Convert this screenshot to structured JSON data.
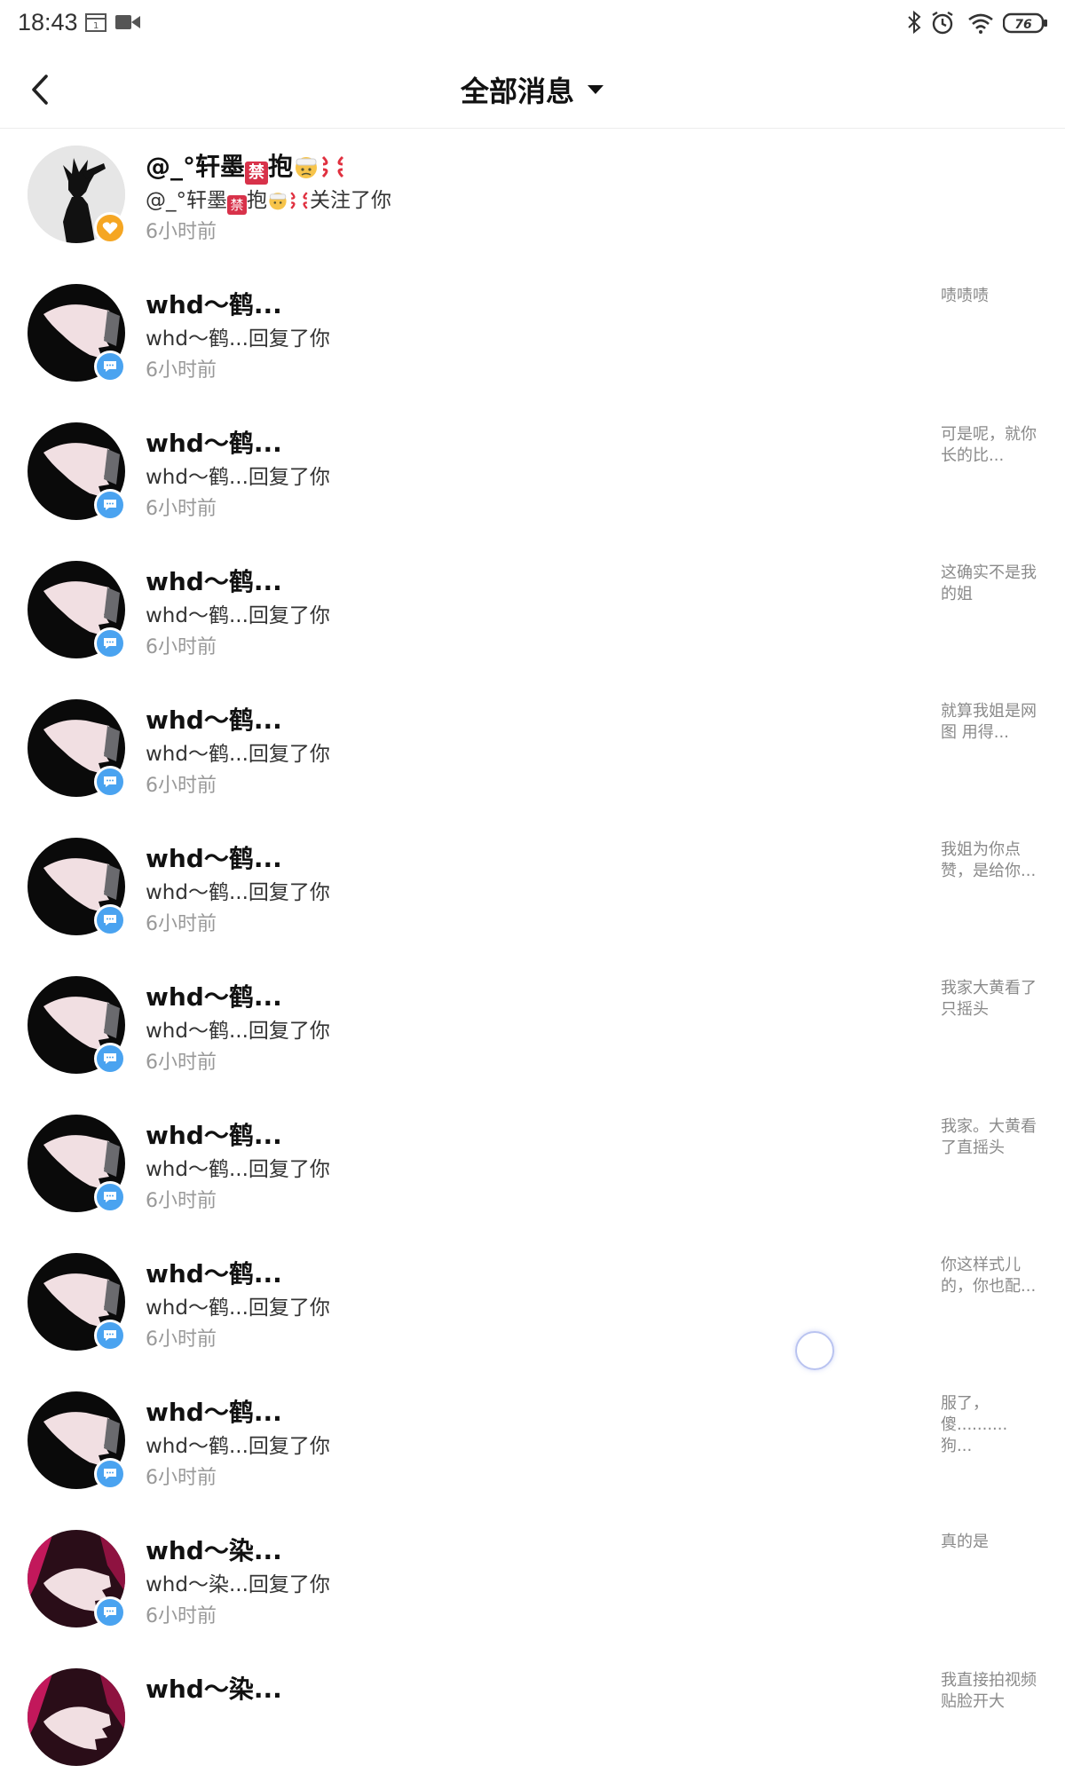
{
  "status_bar": {
    "time": "18:43",
    "battery": "76",
    "icons": [
      "calendar-icon",
      "video-icon",
      "bluetooth-icon",
      "alarm-icon",
      "wifi-icon",
      "battery-icon"
    ]
  },
  "nav": {
    "title": "全部消息",
    "back_icon": "chevron-left-icon",
    "dropdown_icon": "caret-down-icon"
  },
  "colors": {
    "follow_badge": "#f5a623",
    "reply_badge": "#4aa3f0",
    "preview_text": "#8a8a8a",
    "time_text": "#999999"
  },
  "messages": [
    {
      "type": "follow",
      "name_prefix": "@_°轩墨",
      "name_block": "禁",
      "name_suffix": "抱",
      "action_prefix": "@_°轩墨",
      "action_block": "禁",
      "action_suffix": "抱",
      "action_text": "关注了你",
      "time": "6小时前",
      "preview": ""
    },
    {
      "type": "reply",
      "name": "whd～鹤...",
      "action": "whd～鹤...回复了你",
      "time": "6小时前",
      "preview": "啧啧啧"
    },
    {
      "type": "reply",
      "name": "whd～鹤...",
      "action": "whd～鹤...回复了你",
      "time": "6小时前",
      "preview": "可是呢，就你长的比..."
    },
    {
      "type": "reply",
      "name": "whd～鹤...",
      "action": "whd～鹤...回复了你",
      "time": "6小时前",
      "preview": "这确实不是我的姐"
    },
    {
      "type": "reply",
      "name": "whd～鹤...",
      "action": "whd～鹤...回复了你",
      "time": "6小时前",
      "preview": "就算我姐是网图 用得..."
    },
    {
      "type": "reply",
      "name": "whd～鹤...",
      "action": "whd～鹤...回复了你",
      "time": "6小时前",
      "preview": "我姐为你点赞，是给你..."
    },
    {
      "type": "reply",
      "name": "whd～鹤...",
      "action": "whd～鹤...回复了你",
      "time": "6小时前",
      "preview": "我家大黄看了只摇头"
    },
    {
      "type": "reply",
      "name": "whd～鹤...",
      "action": "whd～鹤...回复了你",
      "time": "6小时前",
      "preview": "我家。大黄看了直摇头"
    },
    {
      "type": "reply",
      "name": "whd～鹤...",
      "action": "whd～鹤...回复了你",
      "time": "6小时前",
      "preview": "你这样式儿的，你也配..."
    },
    {
      "type": "reply",
      "name": "whd～鹤...",
      "action": "whd～鹤...回复了你",
      "time": "6小时前",
      "preview": "服了，傻..........狗..."
    },
    {
      "type": "reply_alt",
      "name": "whd～染...",
      "action": "whd～染...回复了你",
      "time": "6小时前",
      "preview": "真的是"
    },
    {
      "type": "reply_alt",
      "name": "whd～染...",
      "action": "",
      "time": "",
      "preview": "我直接拍视频贴脸开大"
    }
  ]
}
